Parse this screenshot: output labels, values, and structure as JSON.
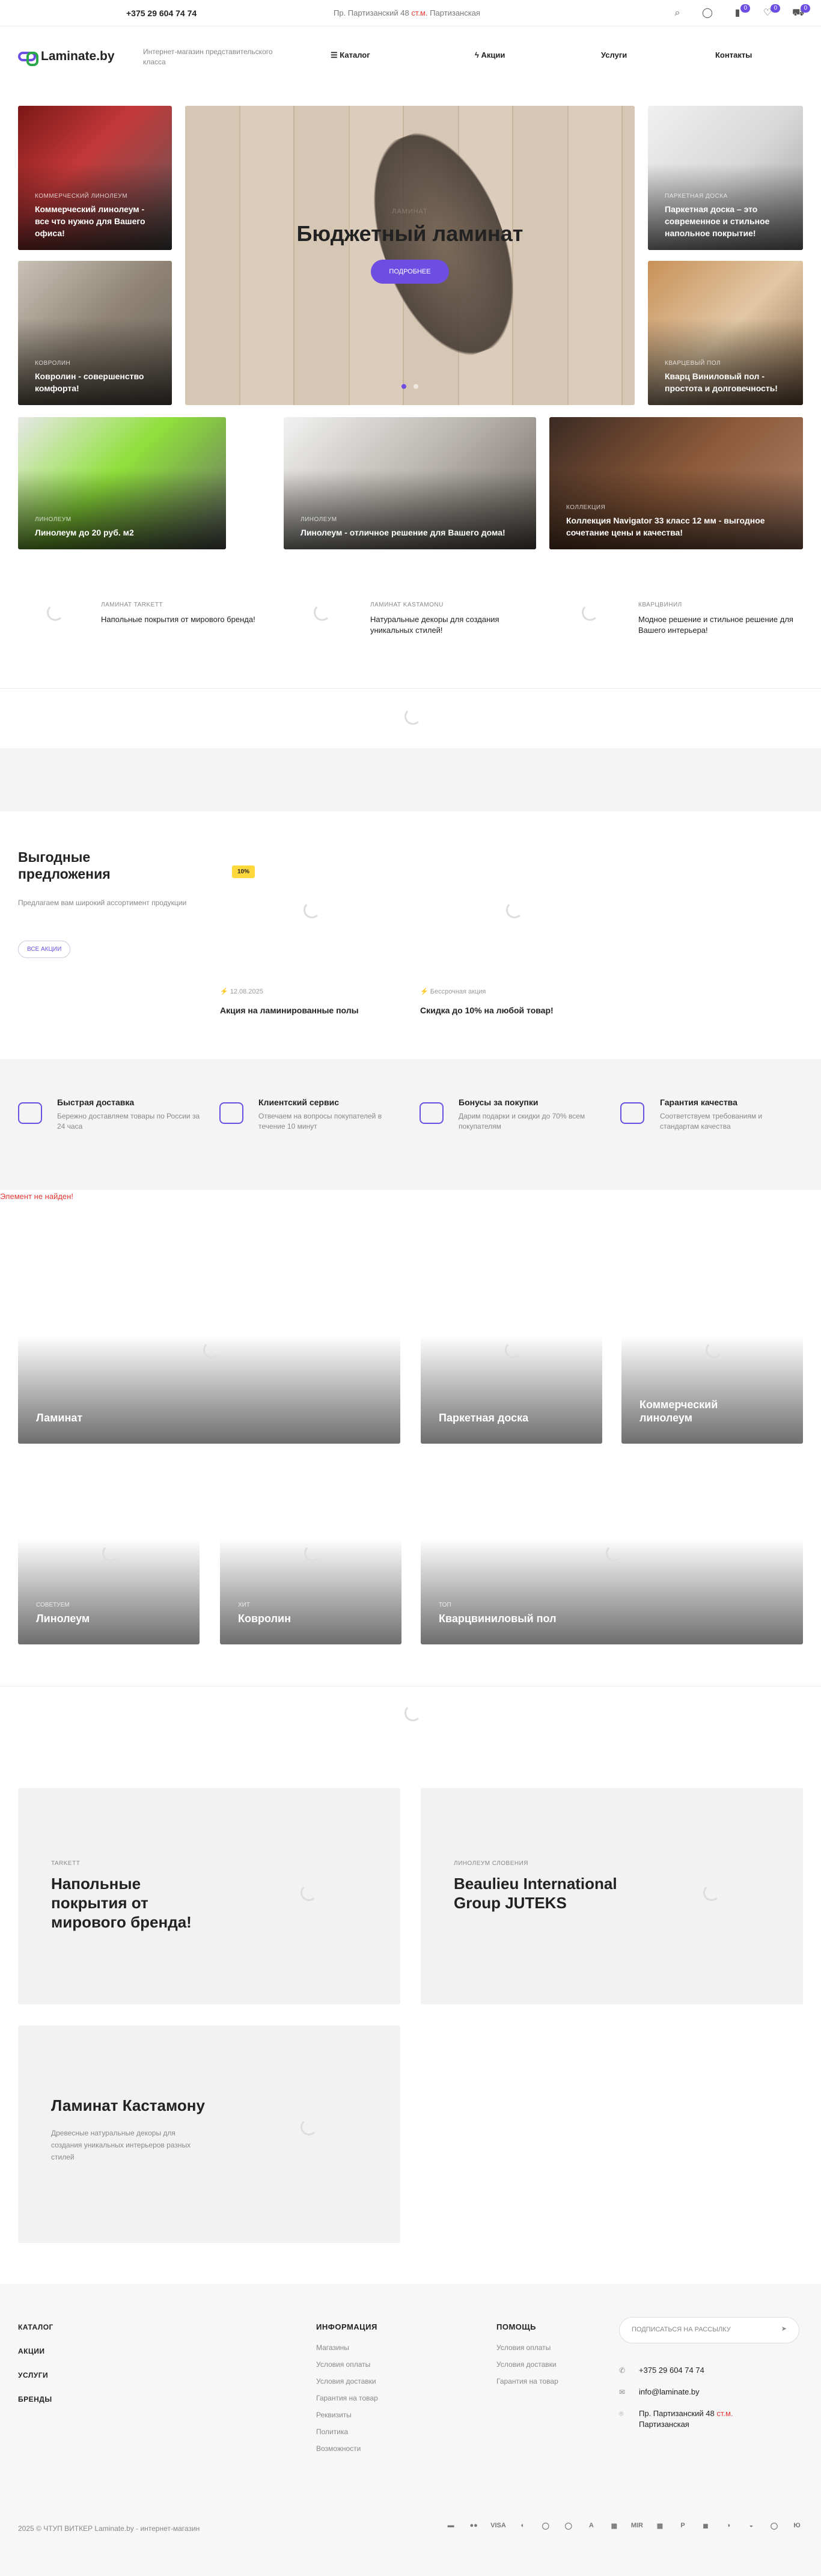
{
  "topbar": {
    "phone": "+375 29 604 74 74",
    "address_prefix": "Пр. Партизанский 48",
    "address_metro": "ст.м.",
    "address_suffix": "Партизанская",
    "compare_count": "0",
    "favorites_count": "0",
    "cart_count": "0"
  },
  "header": {
    "logo": "Laminate.by",
    "tagline": "Интернет-магазин представительского класса",
    "nav": [
      "Каталог",
      "Акции",
      "Услуги",
      "Контакты"
    ]
  },
  "hero": {
    "tiles": [
      {
        "cat": "Коммерческий линолеум",
        "title": "Коммерческий линолеум - все что нужно для Вашего офиса!"
      },
      {
        "cat": "Ковролин",
        "title": "Ковролин - совершенство комфорта!"
      },
      {
        "cat": "Паркетная доска",
        "title": "Паркетная доска – это современное и стильное напольное покрытие!"
      },
      {
        "cat": "Кварцевый пол",
        "title": "Кварц Виниловый пол - простота и долговечность!"
      },
      {
        "cat": "Линолеум",
        "title": "Линолеум до 20 руб. м2"
      },
      {
        "cat": "Линолеум",
        "title": "Линолеум - отличное решение для Вашего дома!"
      },
      {
        "cat": "Коллекция",
        "title": "Коллекция Navigator 33 класс 12 мм - выгодное сочетание цены и качества!"
      }
    ],
    "main": {
      "cat": "Ламинат",
      "title": "Бюджетный ламинат",
      "button": "Подробнее"
    }
  },
  "brands": [
    {
      "cat": "Ламинат Tarkett",
      "text": "Напольные покрытия от мирового бренда!"
    },
    {
      "cat": "Ламинат Kastamonu",
      "text": "Натуральные декоры для создания уникальных стилей!"
    },
    {
      "cat": "Кварцвинил",
      "text": "Модное решение и стильное решение для Вашего интерьера!"
    }
  ],
  "offers": {
    "title": "Выгодные предложения",
    "desc": "Предлагаем вам широкий ассортимент продукции",
    "button": "Все акции",
    "badge": "10%",
    "items": [
      {
        "meta": "12.08.2025",
        "title": "Акция на ламинированные полы"
      },
      {
        "meta": "Бессрочная акция",
        "title": "Скидка до 10% на любой товар!"
      }
    ]
  },
  "features": [
    {
      "title": "Быстрая доставка",
      "text": "Бережно доставляем товары по России за 24 часа"
    },
    {
      "title": "Клиентский сервис",
      "text": "Отвечаем на вопросы покупателей в течение 10 минут"
    },
    {
      "title": "Бонусы за покупки",
      "text": "Дарим подарки и скидки до 70% всем покупателям"
    },
    {
      "title": "Гарантия качества",
      "text": "Соответствуем требованиям и стандартам качества"
    }
  ],
  "notfound": "Элемент не найден!",
  "categories": [
    {
      "cat": "",
      "title": "Ламинат"
    },
    {
      "cat": "",
      "title": "Паркетная доска"
    },
    {
      "cat": "",
      "title": "Коммерческий линолеум"
    },
    {
      "cat": "Советуем",
      "title": "Линолеум"
    },
    {
      "cat": "Хит",
      "title": "Ковролин"
    },
    {
      "cat": "Топ",
      "title": "Кварцвиниловый пол"
    }
  ],
  "promos": [
    {
      "cat": "Tarkett",
      "title": "Напольные покрытия от мирового бренда!",
      "desc": ""
    },
    {
      "cat": "Линолеум Словения",
      "title": "Beaulieu International Group JUTEKS",
      "desc": ""
    },
    {
      "cat": "",
      "title": "Ламинат Кастамону",
      "desc": "Древесные натуральные декоры для создания уникальных интерьеров разных стилей"
    }
  ],
  "footer": {
    "main_links": [
      "Каталог",
      "Акции",
      "Услуги",
      "Бренды"
    ],
    "info_title": "Информация",
    "info_links": [
      "Магазины",
      "Условия оплаты",
      "Условия доставки",
      "Гарантия на товар",
      "Реквизиты",
      "Политика",
      "Возможности"
    ],
    "help_title": "Помощь",
    "help_links": [
      "Условия оплаты",
      "Условия доставки",
      "Гарантия на товар"
    ],
    "subscribe": "Подписаться на рассылку",
    "phone": "+375 29 604 74 74",
    "email": "info@laminate.by",
    "address_prefix": "Пр. Партизанский 48",
    "address_metro": "ст.м.",
    "address_suffix": "Партизанская",
    "copyright": "2025 © ЧТУП ВИТКЕР Laminate.by - интернет-магазин",
    "payments": [
      "▬",
      "●●",
      "VISA",
      "◐",
      "◯",
      "◯",
      "A",
      "▦",
      "MIR",
      "▦",
      "P",
      "◼",
      "◑",
      "◒",
      "◯",
      "Ю"
    ]
  }
}
